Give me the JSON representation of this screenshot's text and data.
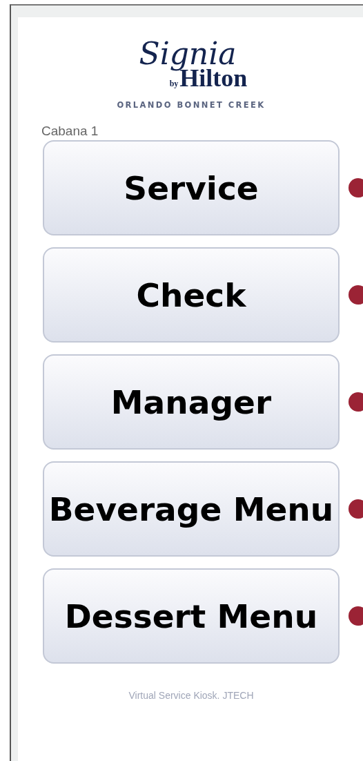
{
  "logo": {
    "script": "Signia",
    "by": "by",
    "brand": "Hilton",
    "location": "ORLANDO BONNET CREEK"
  },
  "location_label": "Cabana 1",
  "buttons": [
    {
      "label": "Service"
    },
    {
      "label": "Check"
    },
    {
      "label": "Manager"
    },
    {
      "label": "Beverage Menu"
    },
    {
      "label": "Dessert Menu"
    }
  ],
  "footer": "Virtual Service Kiosk. JTECH"
}
